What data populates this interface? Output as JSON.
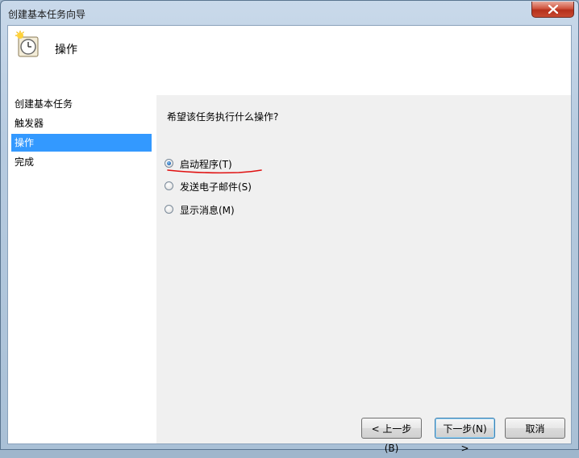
{
  "window": {
    "title": "创建基本任务向导"
  },
  "header": {
    "title": "操作",
    "icon": "clock-icon"
  },
  "nav": {
    "items": [
      {
        "label": "创建基本任务"
      },
      {
        "label": "触发器"
      },
      {
        "label": "操作",
        "selected": true
      },
      {
        "label": "完成"
      }
    ]
  },
  "content": {
    "question": "希望该任务执行什么操作?",
    "options": [
      {
        "label": "启动程序(T)",
        "checked": true
      },
      {
        "label": "发送电子邮件(S)",
        "checked": false
      },
      {
        "label": "显示消息(M)",
        "checked": false
      }
    ]
  },
  "buttons": {
    "back": "< 上一步(B)",
    "next": "下一步(N) >",
    "cancel": "取消"
  },
  "colors": {
    "selection": "#3399ff",
    "annotation": "#e01010"
  }
}
